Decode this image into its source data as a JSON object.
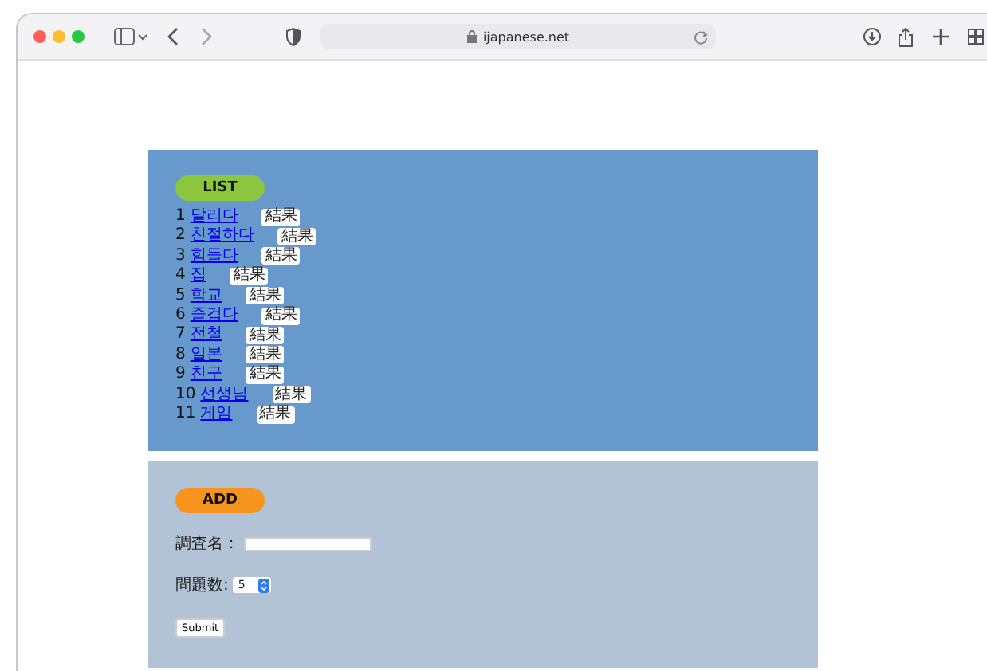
{
  "browser": {
    "address": "ijapanese.net"
  },
  "list": {
    "heading": "LIST",
    "items": [
      {
        "number": "1",
        "word": "달리다",
        "button": "結果"
      },
      {
        "number": "2",
        "word": "친절하다",
        "button": "結果"
      },
      {
        "number": "3",
        "word": "힘들다",
        "button": "結果"
      },
      {
        "number": "4",
        "word": "집",
        "button": "結果"
      },
      {
        "number": "5",
        "word": "학교",
        "button": "結果"
      },
      {
        "number": "6",
        "word": "즐겁다",
        "button": "結果"
      },
      {
        "number": "7",
        "word": "전철",
        "button": "結果"
      },
      {
        "number": "8",
        "word": "일본",
        "button": "結果"
      },
      {
        "number": "9",
        "word": "친구",
        "button": "結果"
      },
      {
        "number": "10",
        "word": "선생님",
        "button": "結果"
      },
      {
        "number": "11",
        "word": "게임",
        "button": "結果"
      }
    ]
  },
  "add": {
    "heading": "ADD",
    "name_label": "調査名：",
    "count_label": "問題数:",
    "count_value": "5",
    "submit": "Submit"
  }
}
